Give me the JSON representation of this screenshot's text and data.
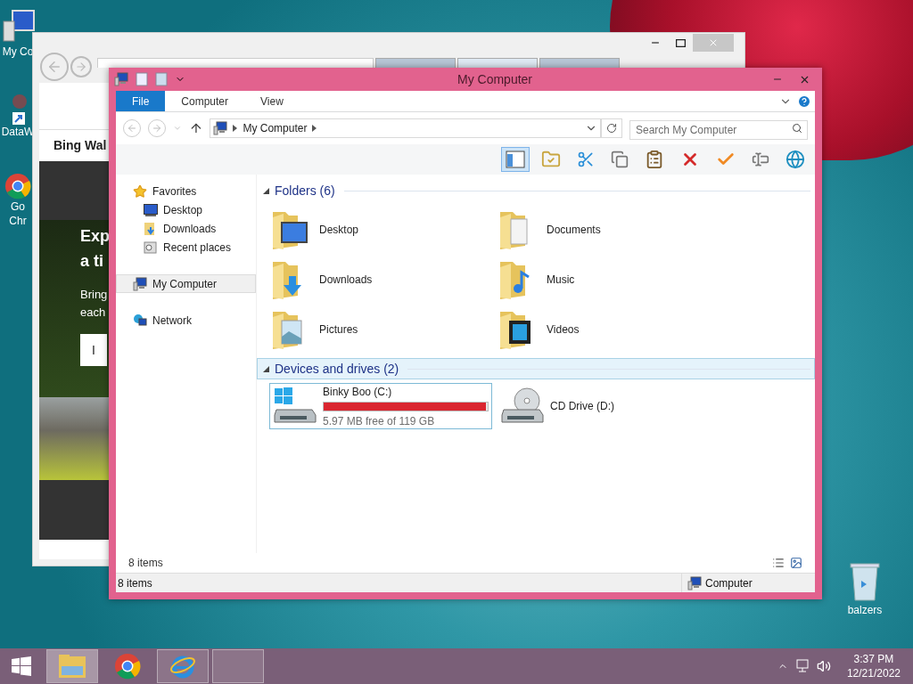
{
  "desktop": {
    "icons": [
      {
        "kind": "computer",
        "lines": [
          "My Co"
        ]
      },
      {
        "kind": "shortcut",
        "lines": [
          "DataW"
        ]
      },
      {
        "kind": "chrome",
        "lines": [
          "Go",
          "Chr"
        ]
      }
    ],
    "recycle_bin": {
      "label": "balzers"
    }
  },
  "browser": {
    "tabs": [
      {
        "selected": false
      },
      {
        "selected": true
      },
      {
        "selected": false
      }
    ],
    "page": {
      "heading": "Bing Wal",
      "hero_lines": [
        "Exp",
        "a ti"
      ],
      "text_lines": [
        "Bring",
        "each"
      ],
      "button": "I"
    }
  },
  "explorer": {
    "title": "My Computer",
    "ribbon_tabs": [
      {
        "label": "File",
        "selected": true
      },
      {
        "label": "Computer",
        "selected": false
      },
      {
        "label": "View",
        "selected": false
      }
    ],
    "address": {
      "path": [
        "My Computer"
      ]
    },
    "search": {
      "placeholder": "Search My Computer"
    },
    "toolbar": [
      {
        "kind": "preview",
        "selected": true
      },
      {
        "kind": "folder-check",
        "selected": false
      },
      {
        "kind": "cut",
        "selected": false
      },
      {
        "kind": "copy",
        "selected": false
      },
      {
        "kind": "paste",
        "selected": false
      },
      {
        "kind": "delete",
        "selected": false
      },
      {
        "kind": "check",
        "selected": false
      },
      {
        "kind": "rename",
        "selected": false
      },
      {
        "kind": "globe",
        "selected": false
      }
    ],
    "navigation": [
      {
        "kind": "favorites",
        "label": "Favorites",
        "selected": false,
        "children": [
          {
            "kind": "desktop",
            "label": "Desktop",
            "selected": false
          },
          {
            "kind": "downloads",
            "label": "Downloads",
            "selected": false
          },
          {
            "kind": "recent",
            "label": "Recent places",
            "selected": false
          }
        ]
      },
      {
        "kind": "computer",
        "label": "My Computer",
        "selected": true
      },
      {
        "kind": "network",
        "label": "Network",
        "selected": false
      }
    ],
    "groups": [
      {
        "kind": "folders",
        "title": "Folders (6)",
        "expanded": true,
        "selected": false,
        "items": [
          {
            "kind": "desktop",
            "label": "Desktop"
          },
          {
            "kind": "documents",
            "label": "Documents"
          },
          {
            "kind": "downloads",
            "label": "Downloads"
          },
          {
            "kind": "music",
            "label": "Music"
          },
          {
            "kind": "pictures",
            "label": "Pictures"
          },
          {
            "kind": "videos",
            "label": "Videos"
          }
        ]
      },
      {
        "kind": "drives",
        "title": "Devices and drives (2)",
        "expanded": true,
        "selected": true,
        "items": [
          {
            "kind": "hdd",
            "label": "Binky Boo (C:)",
            "detail": "5.97 MB free of 119 GB",
            "level": 0.99,
            "selected": true
          },
          {
            "kind": "cd",
            "label": "CD Drive (D:)",
            "selected": false
          }
        ]
      }
    ],
    "item_count": "8 items",
    "status_bar": {
      "count": "8 items",
      "location": "Computer"
    }
  },
  "taskbar": {
    "apps": [
      {
        "kind": "explorer",
        "selected": true,
        "running": true
      },
      {
        "kind": "chrome",
        "selected": false,
        "running": false
      },
      {
        "kind": "ie",
        "selected": false,
        "running": true
      },
      {
        "kind": "blank",
        "selected": false,
        "running": true
      }
    ],
    "clock": {
      "time": "3:37 PM",
      "date": "12/21/2022"
    }
  }
}
